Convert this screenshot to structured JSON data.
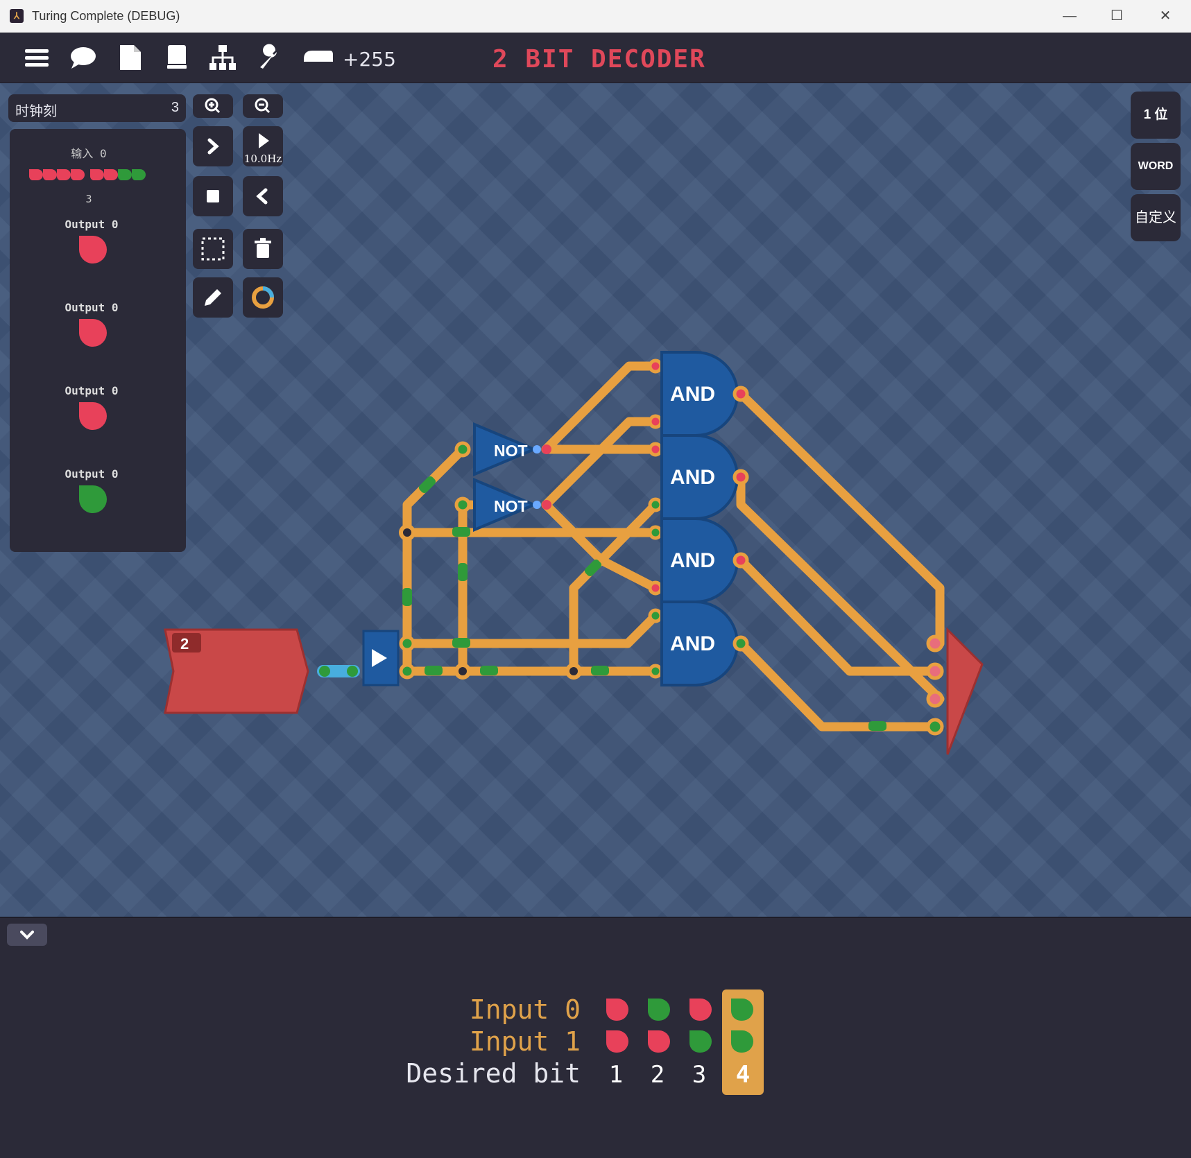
{
  "window": {
    "title": "Turing Complete (DEBUG)"
  },
  "toolbar": {
    "score": "+255",
    "level_title": "2 BIT DECODER"
  },
  "side": {
    "clock_label": "时钟刻",
    "clock_value": "3",
    "input_label": "输入 0",
    "input_value": "3",
    "input_bits": [
      "red",
      "red",
      "red",
      "red",
      "red",
      "red",
      "green",
      "green"
    ],
    "outputs": [
      {
        "label": "Output 0",
        "state": "red"
      },
      {
        "label": "Output 0",
        "state": "red"
      },
      {
        "label": "Output 0",
        "state": "red"
      },
      {
        "label": "Output 0",
        "state": "green"
      }
    ]
  },
  "controls": {
    "speed": "10.0Hz"
  },
  "right_panel": {
    "bits": "1 位",
    "word": "WORD",
    "custom": "自定义"
  },
  "circuit": {
    "input_value": "2",
    "gates": [
      {
        "type": "NOT",
        "label": "NOT"
      },
      {
        "type": "NOT",
        "label": "NOT"
      },
      {
        "type": "AND",
        "label": "AND"
      },
      {
        "type": "AND",
        "label": "AND"
      },
      {
        "type": "AND",
        "label": "AND"
      },
      {
        "type": "AND",
        "label": "AND"
      }
    ]
  },
  "truth_table": {
    "row_labels": [
      "Input 0",
      "Input 1",
      "Desired bit"
    ],
    "input0": [
      "red",
      "green",
      "red",
      "green"
    ],
    "input1": [
      "red",
      "red",
      "green",
      "green"
    ],
    "desired": [
      "1",
      "2",
      "3",
      "4"
    ],
    "highlight_column": 4
  },
  "colors": {
    "red": "#e8415a",
    "green": "#2f9a3a",
    "wire": "#e8a040",
    "gate": "#1f5aa0",
    "title": "#e0485a",
    "orange": "#e0a24a"
  }
}
